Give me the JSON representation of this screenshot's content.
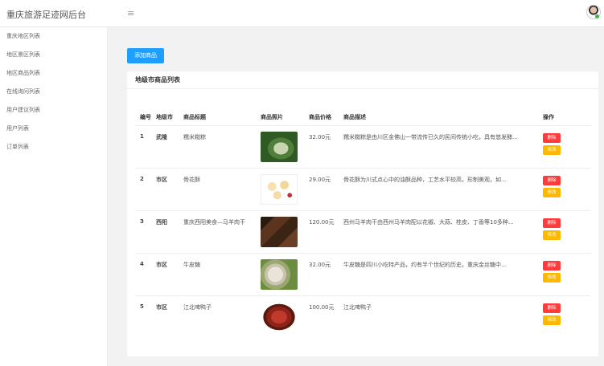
{
  "app": {
    "title": "重庆旅游足迹网后台",
    "menu_icon": "≡"
  },
  "sidebar": {
    "items": [
      {
        "label": "重庆地区列表"
      },
      {
        "label": "地区景区列表"
      },
      {
        "label": "地区商品列表"
      },
      {
        "label": "在线询问列表"
      },
      {
        "label": "用户建议列表"
      },
      {
        "label": "用户列表"
      },
      {
        "label": "订单列表"
      }
    ]
  },
  "toolbar": {
    "add_label": "添加商品"
  },
  "card": {
    "title": "地级市商品列表"
  },
  "table": {
    "headers": {
      "no": "编号",
      "city": "地级市",
      "title": "商品标题",
      "image": "商品照片",
      "price": "商品价格",
      "desc": "商品描述",
      "op": "操作"
    },
    "rows": [
      {
        "no": "1",
        "city": "武隆",
        "title": "糯米糍粽",
        "price": "32.00元",
        "desc": "糯米糍粽是由川区金佛山一带流传已久的民间传统小吃，具有悠发酵...",
        "del": "删除",
        "edit": "修改"
      },
      {
        "no": "2",
        "city": "市区",
        "title": "骨花酥",
        "price": "29.00元",
        "desc": "骨花酥为川式点心中的油酥品种，工艺水平较高，形制美观，如...",
        "del": "删除",
        "edit": "修改"
      },
      {
        "no": "3",
        "city": "西阳",
        "title": "重庆西阳美食—马羊肉干",
        "price": "120.00元",
        "desc": "西州马羊肉干由西州马羊肉配以花椒、大蒜、桂皮、丁香等10多种...",
        "del": "删除",
        "edit": "修改"
      },
      {
        "no": "4",
        "city": "市区",
        "title": "牛皮糖",
        "price": "32.00元",
        "desc": "牛皮糖是四川小吃特产品，约有半个世纪的历史。重庆金丝糖中...",
        "del": "删除",
        "edit": "修改"
      },
      {
        "no": "5",
        "city": "市区",
        "title": "江北啤鸭子",
        "price": "100.00元",
        "desc": "江北啤鸭子",
        "del": "删除",
        "edit": "修改"
      }
    ]
  }
}
